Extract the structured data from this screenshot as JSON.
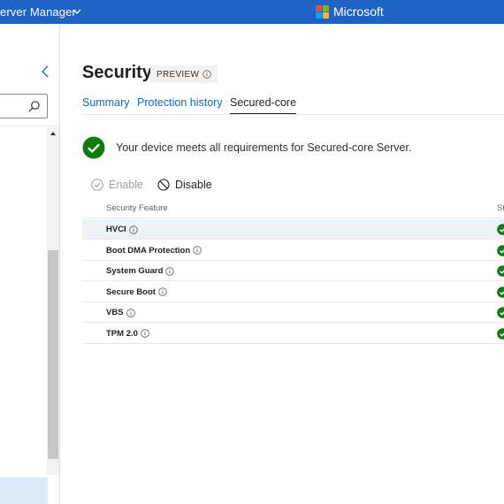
{
  "header": {
    "app_title": "erver Manager",
    "brand": "Microsoft",
    "icons": [
      "chevron-down-icon",
      "microsoft-logo-icon"
    ]
  },
  "sidebar": {
    "search": {
      "value": "",
      "placeholder": ""
    },
    "icons": [
      "chevron-left-icon",
      "search-icon",
      "scroll-up-icon"
    ]
  },
  "page": {
    "title": "Security",
    "badge": "PREVIEW"
  },
  "tabs": [
    {
      "label": "Summary",
      "active": false
    },
    {
      "label": "Protection history",
      "active": false
    },
    {
      "label": "Secured-core",
      "active": true
    }
  ],
  "status_message": "Your device meets all requirements for Secured-core Server.",
  "toolbar": {
    "enable_label": "Enable",
    "disable_label": "Disable"
  },
  "table": {
    "columns": [
      "Security Feature",
      "St"
    ],
    "rows": [
      {
        "feature": "HVCI",
        "status": "check"
      },
      {
        "feature": "Boot DMA Protection",
        "status": "check"
      },
      {
        "feature": "System Guard",
        "status": "check"
      },
      {
        "feature": "Secure Boot",
        "status": "check"
      },
      {
        "feature": "VBS",
        "status": "check"
      },
      {
        "feature": "TPM 2.0",
        "status": "check"
      }
    ],
    "selected_row": 0
  },
  "colors": {
    "header_bg": "#1e63c4",
    "link": "#0f6cbd",
    "success": "#107c10",
    "selected_row": "#edf1f8"
  }
}
